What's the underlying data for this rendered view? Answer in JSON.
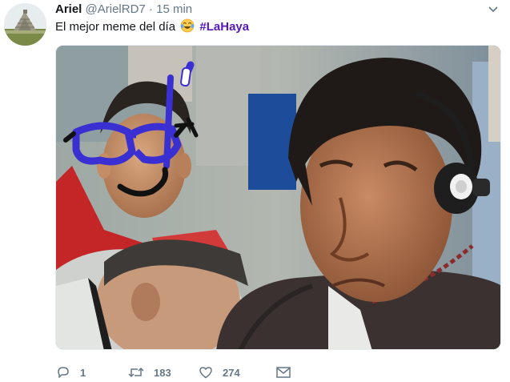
{
  "tweet": {
    "author_name": "Ariel",
    "author_handle": "@ArielRD7",
    "separator": "·",
    "time": "15 min",
    "text": "El mejor meme del día",
    "emoji": "face-with-tears-of-joy",
    "hashtag": "#LaHaya",
    "counts": {
      "replies": "1",
      "retweets": "183",
      "likes": "274"
    }
  },
  "colors": {
    "hashtag": "#5519b8",
    "meta": "#657786",
    "name": "#14171a"
  },
  "icons": {
    "caret": "chevron-down-icon",
    "reply": "reply-icon",
    "retweet": "retweet-icon",
    "like": "heart-icon",
    "message": "envelope-icon"
  }
}
